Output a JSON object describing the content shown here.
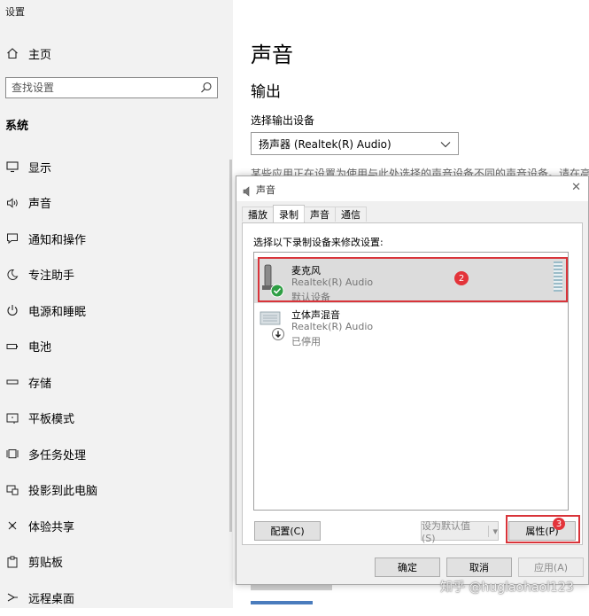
{
  "app": {
    "title": "设置"
  },
  "sidebar": {
    "home_label": "主页",
    "search_placeholder": "查找设置",
    "section_title": "系统",
    "items": [
      {
        "label": "显示",
        "icon": "monitor-icon"
      },
      {
        "label": "声音",
        "icon": "speaker-icon"
      },
      {
        "label": "通知和操作",
        "icon": "notification-icon"
      },
      {
        "label": "专注助手",
        "icon": "moon-icon"
      },
      {
        "label": "电源和睡眠",
        "icon": "power-icon"
      },
      {
        "label": "电池",
        "icon": "battery-icon"
      },
      {
        "label": "存储",
        "icon": "storage-icon"
      },
      {
        "label": "平板模式",
        "icon": "tablet-icon"
      },
      {
        "label": "多任务处理",
        "icon": "multitask-icon"
      },
      {
        "label": "投影到此电脑",
        "icon": "project-icon"
      },
      {
        "label": "体验共享",
        "icon": "share-icon"
      },
      {
        "label": "剪贴板",
        "icon": "clipboard-icon"
      },
      {
        "label": "远程桌面",
        "icon": "remote-desktop-icon"
      }
    ]
  },
  "main": {
    "title": "声音",
    "output_heading": "输出",
    "output_label": "选择输出设备",
    "output_value": "扬声器 (Realtek(R) Audio)",
    "note": "某些应用正在设置为使用与此处选择的声音设备不同的声音设备。请在高"
  },
  "dialog": {
    "title": "声音",
    "tabs": [
      {
        "label": "播放",
        "active": false
      },
      {
        "label": "录制",
        "active": true
      },
      {
        "label": "声音",
        "active": false
      },
      {
        "label": "通信",
        "active": false
      }
    ],
    "instruction": "选择以下录制设备来修改设置:",
    "devices": [
      {
        "name": "麦克风",
        "driver": "Realtek(R) Audio",
        "status": "默认设备",
        "selected": true
      },
      {
        "name": "立体声混音",
        "driver": "Realtek(R) Audio",
        "status": "已停用",
        "selected": false
      }
    ],
    "buttons": {
      "configure": "配置(C)",
      "set_default": "设为默认值(S)",
      "properties": "属性(P)",
      "ok": "确定",
      "cancel": "取消",
      "apply": "应用(A)"
    }
  },
  "annotations": {
    "badge_2": "2",
    "badge_3": "3"
  },
  "watermark": "知乎 @huglaohaol123",
  "colors": {
    "highlight": "#d9343a",
    "badge": "#e3343a",
    "sidebar_bg": "#f2f2f2",
    "dialog_bg": "#f0f0f0"
  }
}
